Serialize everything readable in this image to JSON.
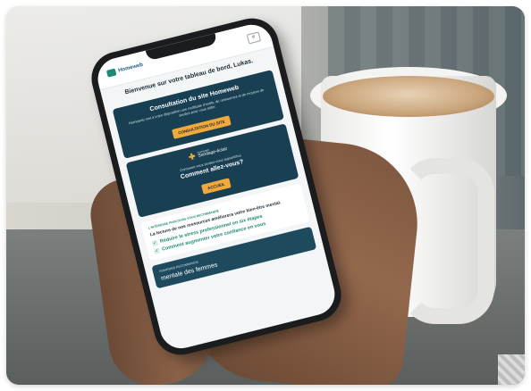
{
  "app": {
    "logo_text": "Homeweb",
    "menu_icon": "menu-icon"
  },
  "dashboard": {
    "welcome": "Bienvenue sur votre tableau de bord, Lukas."
  },
  "consultation_card": {
    "title": "Consultation du site Homeweb",
    "text": "Homeweb met à votre disposition une multitude d'outils, de ressources et de moyens de soutien pour vous aider.",
    "button_label": "CONSULTATION DU SITE"
  },
  "sondage_card": {
    "logo_name": "Sondage-éclair",
    "logo_small": "Homeweb",
    "prompt": "Comment vous sentez-vous aujourd'hui",
    "question": "Comment allez-vous?",
    "button_label": "ACCUEIL"
  },
  "parcours_card": {
    "tag": "L'INTÉRESSE PARCOURS VOUS RECOMMANDE",
    "text": "La lecture de nos ressources améliorera votre bien-être mental.",
    "items": [
      {
        "label": "Réduire le stress professionnel en six étapes"
      },
      {
        "label": "Comment augmenter votre confiance en vous"
      }
    ]
  },
  "bottom_card": {
    "tag": "HOMEWEB RECOMMANDE",
    "title": "mentale des femmes"
  },
  "colors": {
    "card_dark": "#183f52",
    "accent_orange": "#f2a93b",
    "accent_green": "#1f8a73"
  }
}
